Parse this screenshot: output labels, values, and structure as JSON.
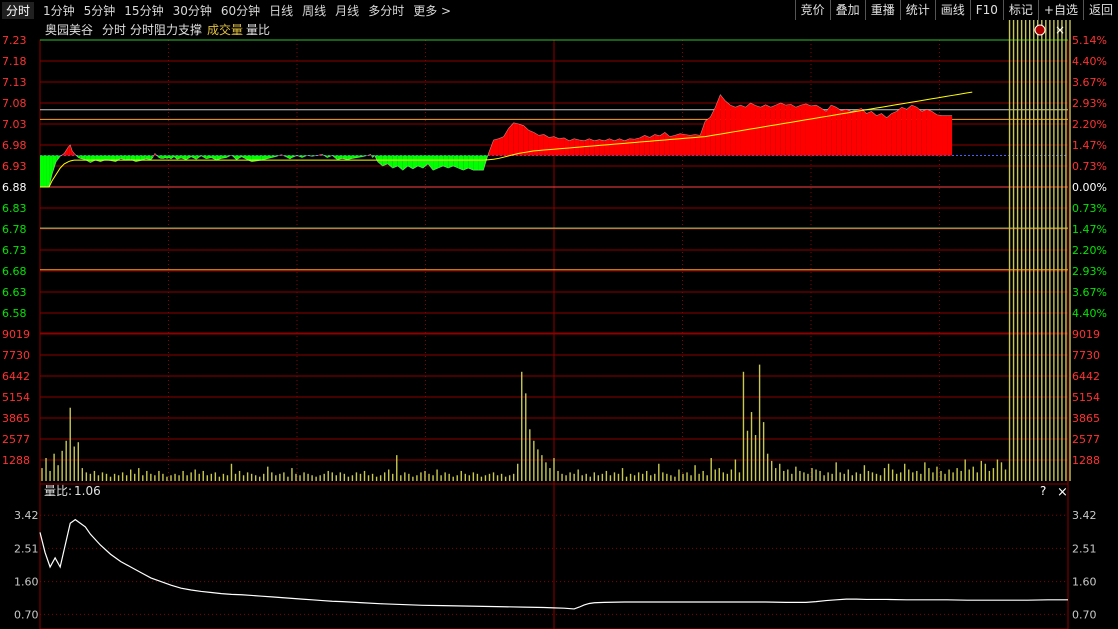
{
  "toolbar": {
    "tabs": [
      "分时",
      "1分钟",
      "5分钟",
      "15分钟",
      "30分钟",
      "60分钟",
      "日线",
      "周线",
      "月线",
      "多分时",
      "更多 >"
    ],
    "buttons": [
      "竞价",
      "叠加",
      "重播",
      "统计",
      "画线",
      "F10",
      "标记",
      "+自选",
      "返回"
    ]
  },
  "price_header": {
    "stock_name": "奥园美谷",
    "items": [
      "分时",
      "分时阻力支撑"
    ],
    "volume_label": "成交量",
    "ratio_label": "量比"
  },
  "ratio_header": {
    "label": "量比:",
    "value": "1.06"
  },
  "icons": {
    "help": "?",
    "close": "×",
    "price_close": "×"
  },
  "colors": {
    "up": "#ff0000",
    "down": "#00ff00",
    "price_line": "#ffffff",
    "avg_line": "#ffff00",
    "grid": "#8b0000",
    "volume_bar": "#c8c850",
    "axis_red": "#ff3232",
    "axis_green": "#00e600",
    "accent_orange": "#ffa020",
    "accent_lime": "#a0e070"
  },
  "chart_data": [
    {
      "type": "area",
      "name": "price",
      "y_ticks": [
        "7.23",
        "7.18",
        "7.13",
        "7.08",
        "7.03",
        "6.98",
        "6.93",
        "6.88",
        "6.83",
        "6.78",
        "6.73",
        "6.68",
        "6.63",
        "6.58"
      ],
      "pct_ticks": [
        "5.14%",
        "4.40%",
        "3.67%",
        "2.93%",
        "2.20%",
        "1.47%",
        "0.73%",
        "0.00%",
        "0.73%",
        "1.47%",
        "2.20%",
        "2.93%",
        "3.67%",
        "4.40%"
      ],
      "ylim": [
        6.58,
        7.23
      ],
      "prev_close": 6.88,
      "reference_lines": [
        7.064,
        7.041,
        6.782,
        6.683
      ],
      "x": [
        0,
        3,
        6,
        9,
        12,
        16,
        20,
        24,
        28,
        30,
        32,
        34,
        36,
        38,
        40,
        45,
        50,
        55,
        60,
        65,
        70,
        75,
        80,
        85,
        90,
        95,
        100,
        105,
        110,
        112,
        114,
        116,
        118,
        120,
        121,
        122,
        123,
        124,
        126,
        128,
        130,
        133,
        136,
        140,
        145,
        150,
        155,
        160,
        165,
        170,
        175,
        180,
        185,
        190,
        195,
        200,
        210,
        220,
        230,
        235,
        238,
        240,
        242,
        244,
        248,
        250,
        255,
        260,
        262,
        265,
        270,
        275,
        280,
        285,
        290,
        295,
        300,
        305,
        310,
        315,
        320,
        325,
        328,
        330,
        332,
        335,
        340,
        345,
        350,
        355,
        360,
        365,
        370,
        375,
        380,
        385,
        390,
        395,
        400,
        405,
        410,
        415,
        420,
        425,
        430,
        435,
        440,
        445,
        450,
        455,
        460,
        465,
        470,
        475,
        480,
        485,
        490,
        495,
        500,
        505,
        510,
        515,
        520,
        525,
        530,
        535,
        540,
        545,
        550,
        555,
        560,
        565,
        570,
        575,
        580,
        585,
        590,
        595,
        600,
        605,
        610,
        615,
        620,
        625,
        630,
        635,
        640,
        645,
        650,
        655,
        660,
        665,
        670,
        675,
        680,
        685,
        690,
        695,
        700,
        705,
        710,
        715,
        720,
        725,
        730,
        735,
        740,
        745,
        750,
        755,
        760,
        765,
        770,
        775,
        780,
        785,
        790,
        795,
        800,
        805,
        810,
        815,
        820,
        825,
        830,
        835,
        840,
        845,
        850,
        855,
        860,
        865,
        870,
        875,
        880,
        885,
        890,
        895,
        900,
        905,
        910,
        915,
        920,
        925,
        930,
        935,
        940,
        945,
        950,
        955,
        960,
        965,
        970,
        975,
        980,
        985,
        990,
        995,
        1000,
        1005,
        1010,
        1015,
        1020
      ],
      "price": [
        6.88,
        6.88,
        6.88,
        6.88,
        6.91,
        6.94,
        6.953,
        6.96,
        6.975,
        6.98,
        6.966,
        6.96,
        6.955,
        6.95,
        6.948,
        6.945,
        6.938,
        6.944,
        6.94,
        6.945,
        6.943,
        6.94,
        6.948,
        6.944,
        6.946,
        6.94,
        6.943,
        6.947,
        6.945,
        6.95,
        6.96,
        6.955,
        6.95,
        6.948,
        6.948,
        6.948,
        6.948,
        6.95,
        6.948,
        6.95,
        6.947,
        6.952,
        6.946,
        6.949,
        6.945,
        6.952,
        6.946,
        6.954,
        6.947,
        6.95,
        6.944,
        6.948,
        6.95,
        6.956,
        6.945,
        6.952,
        6.94,
        6.944,
        6.95,
        6.953,
        6.956,
        6.957,
        6.954,
        6.952,
        6.947,
        6.95,
        6.955,
        6.95,
        6.952,
        6.955,
        6.953,
        6.955,
        6.958,
        6.95,
        6.955,
        6.945,
        6.948,
        6.945,
        6.948,
        6.95,
        6.952,
        6.955,
        6.958,
        6.95,
        6.955,
        6.94,
        6.93,
        6.935,
        6.925,
        6.93,
        6.92,
        6.93,
        6.923,
        6.93,
        6.925,
        6.935,
        6.92,
        6.925,
        6.93,
        6.925,
        6.93,
        6.925,
        6.92,
        6.925,
        6.92,
        6.92,
        6.92,
        6.96,
        6.992,
        6.995,
        7.0,
        7.02,
        7.033,
        7.03,
        7.026,
        7.015,
        7.01,
        7.003,
        7.005,
        6.998,
        7.0,
        6.995,
        6.997,
        6.99,
        6.995,
        6.992,
        6.99,
        6.995,
        6.99,
        6.993,
        6.99,
        6.995,
        6.99,
        6.995,
        6.99,
        6.995,
        6.994,
        6.997,
        7.003,
        6.998,
        7.005,
        7.002,
        7.01,
        7.0,
        7.003,
        7.007,
        7.005,
        7.003,
        7.005,
        7.003,
        7.037,
        7.046,
        7.07,
        7.1,
        7.085,
        7.075,
        7.07,
        7.075,
        7.07,
        7.08,
        7.074,
        7.07,
        7.076,
        7.07,
        7.075,
        7.08,
        7.075,
        7.077,
        7.07,
        7.075,
        7.078,
        7.073,
        7.075,
        7.068,
        7.06,
        7.075,
        7.07,
        7.062,
        7.065,
        7.06,
        7.063,
        7.067,
        7.055,
        7.06,
        7.05,
        7.055,
        7.045,
        7.055,
        7.06,
        7.07,
        7.065,
        7.075,
        7.07,
        7.06,
        7.065,
        7.06,
        7.052,
        7.05,
        7.05,
        7.05
      ],
      "avg": [
        6.88,
        6.88,
        6.88,
        6.88,
        6.895,
        6.91,
        6.925,
        6.935,
        6.94,
        6.942,
        6.943,
        6.944,
        6.944,
        6.944,
        6.944,
        6.944,
        6.944,
        6.944,
        6.944,
        6.944,
        6.944,
        6.944,
        6.944,
        6.944,
        6.944,
        6.944,
        6.944,
        6.944,
        6.944,
        6.944,
        6.944,
        6.944,
        6.944,
        6.944,
        6.944,
        6.944,
        6.944,
        6.944,
        6.944,
        6.944,
        6.944,
        6.944,
        6.944,
        6.944,
        6.944,
        6.944,
        6.944,
        6.944,
        6.944,
        6.944,
        6.944,
        6.944,
        6.944,
        6.944,
        6.944,
        6.944,
        6.944,
        6.944,
        6.944,
        6.944,
        6.944,
        6.944,
        6.944,
        6.944,
        6.944,
        6.944,
        6.944,
        6.944,
        6.944,
        6.944,
        6.944,
        6.944,
        6.944,
        6.944,
        6.944,
        6.944,
        6.944,
        6.944,
        6.944,
        6.944,
        6.944,
        6.944,
        6.944,
        6.944,
        6.944,
        6.944,
        6.944,
        6.944,
        6.944,
        6.944,
        6.944,
        6.944,
        6.944,
        6.944,
        6.944,
        6.944,
        6.944,
        6.944,
        6.944,
        6.944,
        6.944,
        6.944,
        6.944,
        6.944,
        6.944,
        6.944,
        6.944,
        6.945,
        6.946,
        6.948,
        6.951,
        6.954,
        6.957,
        6.96,
        6.962,
        6.964,
        6.966,
        6.967,
        6.968,
        6.969,
        6.97,
        6.971,
        6.972,
        6.973,
        6.974,
        6.975,
        6.976,
        6.977,
        6.978,
        6.979,
        6.98,
        6.981,
        6.982,
        6.983,
        6.984,
        6.985,
        6.986,
        6.987,
        6.988,
        6.989,
        6.99,
        6.991,
        6.992,
        6.993,
        6.994,
        6.995,
        6.996,
        6.997,
        6.998,
        6.999,
        7.0,
        7.002,
        7.004,
        7.006,
        7.008,
        7.01,
        7.012,
        7.014,
        7.016,
        7.018,
        7.02,
        7.022,
        7.024,
        7.026,
        7.028,
        7.03,
        7.032,
        7.034,
        7.036,
        7.038,
        7.04,
        7.042,
        7.044,
        7.046,
        7.048,
        7.05,
        7.052,
        7.054,
        7.056,
        7.058,
        7.06,
        7.062,
        7.064,
        7.066,
        7.068,
        7.07,
        7.072,
        7.074,
        7.076,
        7.078,
        7.08,
        7.082,
        7.084,
        7.086,
        7.088,
        7.09,
        7.092,
        7.094,
        7.096,
        7.098,
        7.1,
        7.102,
        7.104,
        7.106
      ]
    },
    {
      "type": "bar",
      "name": "volume",
      "y_ticks": [
        "9019",
        "7730",
        "6442",
        "5154",
        "3865",
        "2577",
        "1288"
      ],
      "ylim": [
        0,
        10300
      ],
      "x": [
        0,
        4,
        8,
        12,
        16,
        20,
        24,
        28,
        32,
        36,
        40,
        44,
        48,
        52,
        56,
        60,
        64,
        68,
        72,
        76,
        80,
        84,
        88,
        92,
        96,
        100,
        104,
        108,
        112,
        116,
        120,
        124,
        128,
        132,
        136,
        140,
        144,
        148,
        152,
        156,
        160,
        164,
        168,
        172,
        176,
        180,
        184,
        188,
        192,
        196,
        200,
        204,
        208,
        212,
        216,
        220,
        224,
        228,
        232,
        236,
        240,
        244,
        248,
        252,
        256,
        260,
        264,
        268,
        272,
        276,
        280,
        284,
        288,
        292,
        296,
        300,
        304,
        308,
        312,
        316,
        320,
        324,
        328,
        332,
        336,
        340,
        344,
        348,
        352,
        356,
        360,
        364,
        368,
        372,
        376,
        380,
        384,
        388,
        392,
        396,
        400,
        404,
        408,
        412,
        416,
        420,
        424,
        428,
        432,
        436,
        440,
        444,
        448,
        452,
        456,
        460,
        464,
        468,
        472,
        476,
        480,
        484,
        488,
        492,
        496,
        500,
        504,
        508,
        512,
        516,
        520,
        524,
        528,
        532,
        536,
        540,
        544,
        548,
        552,
        556,
        560,
        564,
        568,
        572,
        576,
        580,
        584,
        588,
        592,
        596,
        600,
        604,
        608,
        612,
        616,
        620,
        624,
        628,
        632,
        636,
        640,
        644,
        648,
        652,
        656,
        660,
        664,
        668,
        672,
        676,
        680,
        684,
        688,
        692,
        696,
        700,
        704,
        708,
        712,
        716,
        720,
        724,
        728,
        732,
        736,
        740,
        744,
        748,
        752,
        756,
        760,
        764,
        768,
        772,
        776,
        780,
        784,
        788,
        792,
        796,
        800,
        804,
        808,
        812,
        816,
        820,
        824,
        828,
        832,
        836,
        840,
        844,
        848,
        852,
        856,
        860,
        864,
        868,
        872,
        876,
        880,
        884,
        888,
        892,
        896,
        900,
        904,
        908,
        912,
        916,
        920,
        924,
        928,
        932,
        936,
        940,
        944,
        948,
        952,
        956,
        960,
        964,
        968,
        972,
        976,
        980,
        984,
        988,
        992,
        996,
        1000,
        1004,
        1008,
        1012,
        1016,
        1020
      ],
      "values": [
        900,
        1600,
        700,
        1900,
        1100,
        2100,
        2800,
        5100,
        2400,
        2700,
        900,
        600,
        500,
        700,
        400,
        600,
        500,
        300,
        500,
        400,
        600,
        400,
        800,
        500,
        900,
        400,
        700,
        500,
        400,
        700,
        500,
        300,
        400,
        500,
        400,
        700,
        400,
        600,
        800,
        500,
        700,
        400,
        500,
        600,
        300,
        500,
        400,
        1200,
        500,
        700,
        400,
        600,
        500,
        400,
        300,
        500,
        1000,
        600,
        400,
        500,
        600,
        300,
        900,
        500,
        400,
        600,
        500,
        400,
        300,
        400,
        500,
        700,
        600,
        400,
        600,
        500,
        300,
        400,
        600,
        500,
        700,
        400,
        500,
        300,
        400,
        600,
        800,
        500,
        1800,
        400,
        600,
        500,
        300,
        400,
        600,
        700,
        500,
        400,
        800,
        400,
        600,
        500,
        300,
        400,
        700,
        500,
        400,
        600,
        500,
        300,
        400,
        500,
        600,
        400,
        500,
        300,
        400,
        500,
        1200,
        7600,
        6100,
        3600,
        2800,
        2200,
        1800,
        1300,
        900,
        1600,
        700,
        500,
        400,
        600,
        500,
        800,
        400,
        500,
        300,
        600,
        400,
        500,
        700,
        400,
        600,
        500,
        900,
        300,
        500,
        400,
        600,
        500,
        700,
        400,
        500,
        1200,
        600,
        500,
        400,
        300,
        800,
        500,
        600,
        400,
        1100,
        500,
        700,
        400,
        1600,
        800,
        900,
        600,
        500,
        800,
        1500,
        600,
        7600,
        3500,
        4800,
        3200,
        8100,
        4100,
        1900,
        1400,
        900,
        1200,
        700,
        800,
        500,
        1000,
        700,
        600,
        500,
        900,
        800,
        700,
        400,
        600,
        500,
        1300,
        600,
        500,
        800,
        400,
        600,
        500,
        1100,
        700,
        600,
        500,
        400,
        900,
        1200,
        800,
        500,
        600,
        1200,
        800,
        600,
        700,
        500,
        1300,
        900,
        600,
        1000,
        700,
        500,
        800,
        600,
        900,
        700,
        1500,
        800,
        1000,
        600,
        1400,
        1200,
        700,
        900,
        1500,
        1300,
        800
      ]
    },
    {
      "type": "line",
      "name": "volume_ratio",
      "y_ticks": [
        "3.42",
        "2.51",
        "1.60",
        "0.70"
      ],
      "ylim": [
        0.3,
        3.7
      ],
      "x": [
        0,
        5,
        10,
        15,
        20,
        25,
        30,
        35,
        40,
        45,
        50,
        60,
        70,
        80,
        90,
        100,
        110,
        120,
        130,
        140,
        150,
        160,
        170,
        180,
        190,
        200,
        210,
        220,
        230,
        240,
        250,
        260,
        270,
        280,
        290,
        300,
        320,
        340,
        360,
        380,
        400,
        420,
        440,
        460,
        480,
        500,
        510,
        520,
        530,
        535,
        540,
        545,
        550,
        560,
        580,
        600,
        620,
        640,
        660,
        680,
        700,
        720,
        740,
        750,
        760,
        770,
        780,
        790,
        800,
        810,
        820,
        830,
        840,
        860,
        880,
        900,
        920,
        940,
        960,
        980,
        1000,
        1020
      ],
      "values": [
        2.95,
        2.4,
        2.0,
        2.25,
        2.0,
        2.6,
        3.2,
        3.3,
        3.2,
        3.1,
        2.9,
        2.6,
        2.35,
        2.15,
        2.0,
        1.85,
        1.7,
        1.6,
        1.5,
        1.42,
        1.37,
        1.33,
        1.3,
        1.27,
        1.25,
        1.24,
        1.22,
        1.2,
        1.18,
        1.16,
        1.14,
        1.12,
        1.1,
        1.08,
        1.06,
        1.05,
        1.02,
        0.99,
        0.97,
        0.95,
        0.94,
        0.93,
        0.92,
        0.91,
        0.9,
        0.89,
        0.88,
        0.87,
        0.85,
        0.9,
        0.96,
        1.0,
        1.02,
        1.03,
        1.04,
        1.04,
        1.04,
        1.04,
        1.04,
        1.04,
        1.04,
        1.04,
        1.03,
        1.03,
        1.03,
        1.05,
        1.08,
        1.1,
        1.12,
        1.12,
        1.11,
        1.11,
        1.11,
        1.1,
        1.1,
        1.1,
        1.09,
        1.09,
        1.09,
        1.09,
        1.1,
        1.1
      ]
    }
  ]
}
